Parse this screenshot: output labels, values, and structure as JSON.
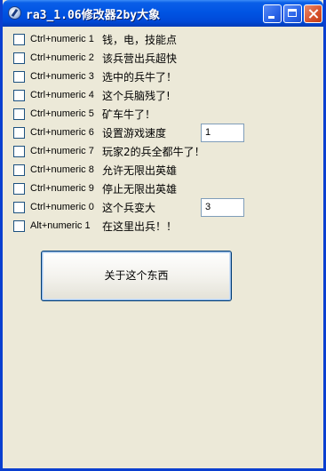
{
  "window": {
    "title": "ra3_1.06修改器2by大象"
  },
  "options": [
    {
      "hotkey": "Ctrl+numeric 1",
      "label": "钱，电，技能点"
    },
    {
      "hotkey": "Ctrl+numeric 2",
      "label": "该兵营出兵超快"
    },
    {
      "hotkey": "Ctrl+numeric 3",
      "label": "选中的兵牛了！"
    },
    {
      "hotkey": "Ctrl+numeric 4",
      "label": "这个兵脑残了!"
    },
    {
      "hotkey": "Ctrl+numeric 5",
      "label": "矿车牛了！"
    },
    {
      "hotkey": "Ctrl+numeric 6",
      "label": "设置游戏速度"
    },
    {
      "hotkey": "Ctrl+numeric 7",
      "label": "玩家2的兵全都牛了！"
    },
    {
      "hotkey": "Ctrl+numeric 8",
      "label": "允许无限出英雄"
    },
    {
      "hotkey": "Ctrl+numeric 9",
      "label": "停止无限出英雄"
    },
    {
      "hotkey": "Ctrl+numeric 0",
      "label": "这个兵变大"
    },
    {
      "hotkey": "Alt+numeric 1",
      "label": "在这里出兵！！"
    }
  ],
  "speed_input": {
    "value": "1"
  },
  "size_input": {
    "value": "3"
  },
  "about_button": {
    "label": "关于这个东西"
  },
  "colors": {
    "titlebar": "#0054e3",
    "face": "#ece9d8",
    "close": "#d6512b"
  }
}
